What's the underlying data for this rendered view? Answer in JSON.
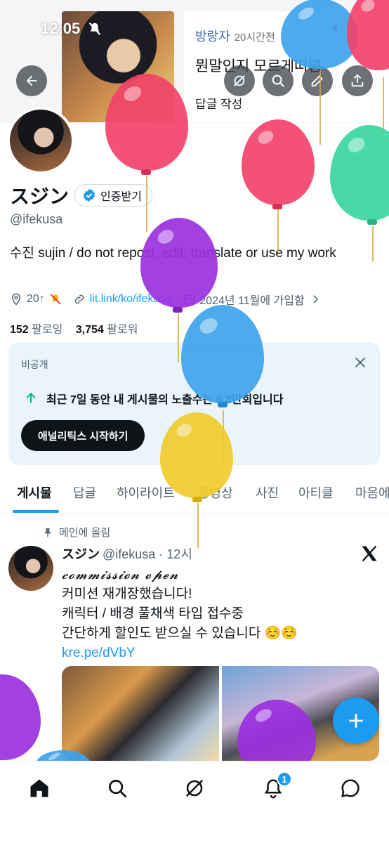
{
  "status_bar": {
    "time": "12:05"
  },
  "banner": {
    "user": "방랑자",
    "time": "20시간전",
    "text": "뭔말인지 모르게떠염",
    "reply": "답글 작성"
  },
  "profile": {
    "name": "スジン",
    "verify_label": "인증받기",
    "handle": "@ifekusa",
    "bio": "수진 sujin / do not repost, edit, translate or use my work",
    "location": "20↑",
    "website": "lit.link/ko/ifekusa",
    "joined": "2024년 11월에 가입함",
    "following_count": "152",
    "following_label": "팔로잉",
    "followers_count": "3,754",
    "followers_label": "팔로워"
  },
  "analytics_card": {
    "label": "비공개",
    "stat": "최근 7일 동안 내 게시물의 노출수는 6.3만회입니다",
    "button": "애널리틱스 시작하기"
  },
  "tabs": [
    "게시물",
    "답글",
    "하이라이트",
    "동영상",
    "사진",
    "아티클",
    "마음에"
  ],
  "post": {
    "pinned_label": "메인에 올림",
    "author_name": "スジン",
    "author_handle": "@ifekusa · 12시",
    "line1": "𝓬𝓸𝓶𝓶𝓲𝓼𝓼𝓲𝓸𝓷 𝓸𝓹𝓮𝓷",
    "line2": "커미션 재개장했습니다!",
    "line3": "캐릭터 / 배경 풀채색 타입 접수중",
    "line4": "간단하게 할인도 받으실 수 있습니다 ☺️☺️",
    "link": "kre.pe/dVbY"
  },
  "bottom_nav": {
    "notification_badge": "1"
  },
  "colors": {
    "accent": "#1d9bf0",
    "text": "#0f1419",
    "muted": "#536471",
    "card_bg": "#e9f5fb"
  },
  "icons": [
    "back-arrow-icon",
    "grok-icon",
    "search-icon",
    "edit-icon",
    "share-icon",
    "verified-icon",
    "location-icon",
    "muted-bell-icon",
    "link-icon",
    "calendar-icon",
    "chevron-right-icon",
    "close-icon",
    "arrow-up-icon",
    "pin-icon",
    "x-logo-icon",
    "plus-icon",
    "home-icon",
    "bell-icon",
    "messages-icon"
  ]
}
